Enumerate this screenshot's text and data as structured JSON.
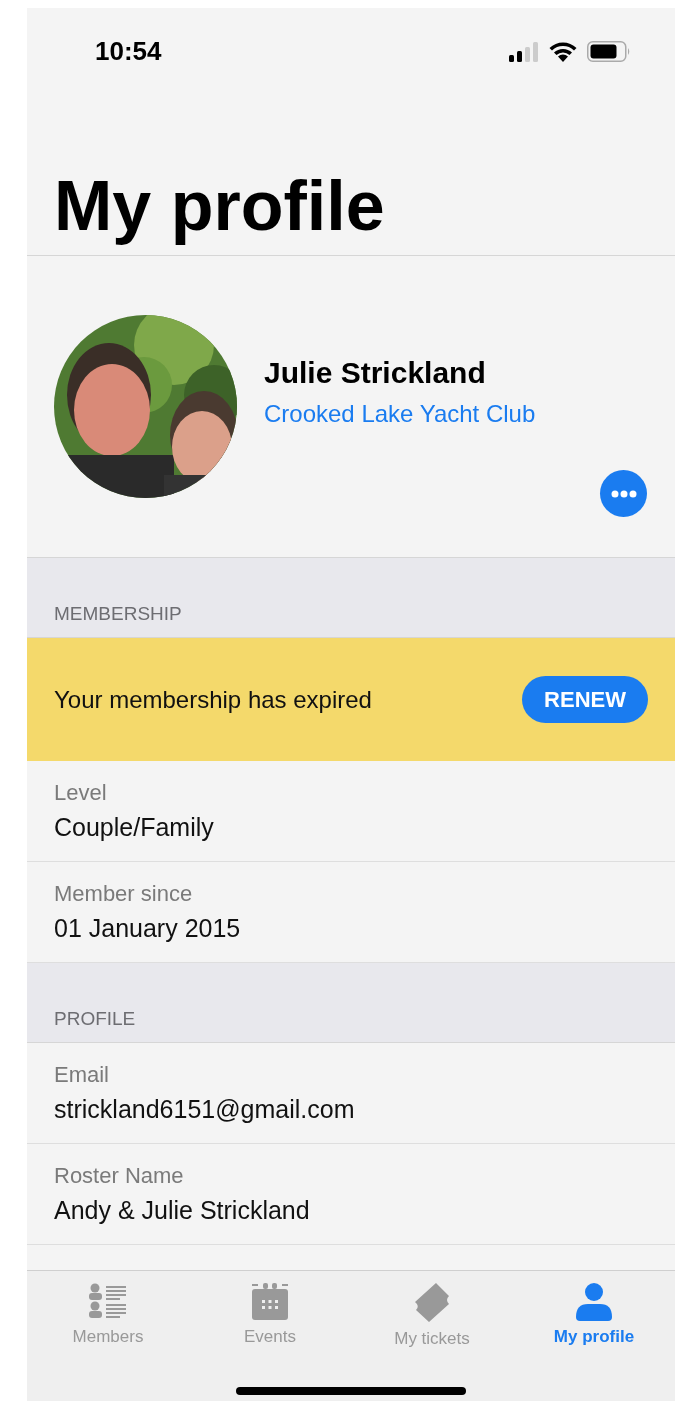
{
  "status_bar": {
    "time": "10:54"
  },
  "title": "My profile",
  "profile": {
    "name": "Julie Strickland",
    "club": "Crooked Lake Yacht Club"
  },
  "sections": [
    {
      "header": "MEMBERSHIP",
      "banner": {
        "message": "Your membership has expired",
        "button": "RENEW"
      },
      "rows": [
        {
          "label": "Level",
          "value": "Couple/Family"
        },
        {
          "label": "Member since",
          "value": "01 January 2015"
        }
      ]
    },
    {
      "header": "PROFILE",
      "rows": [
        {
          "label": "Email",
          "value": "strickland6151@gmail.com"
        },
        {
          "label": "Roster Name",
          "value": "Andy & Julie Strickland"
        }
      ]
    }
  ],
  "tabs": [
    {
      "label": "Members",
      "selected": false
    },
    {
      "label": "Events",
      "selected": false
    },
    {
      "label": "My tickets",
      "selected": false
    },
    {
      "label": "My profile",
      "selected": true
    }
  ]
}
